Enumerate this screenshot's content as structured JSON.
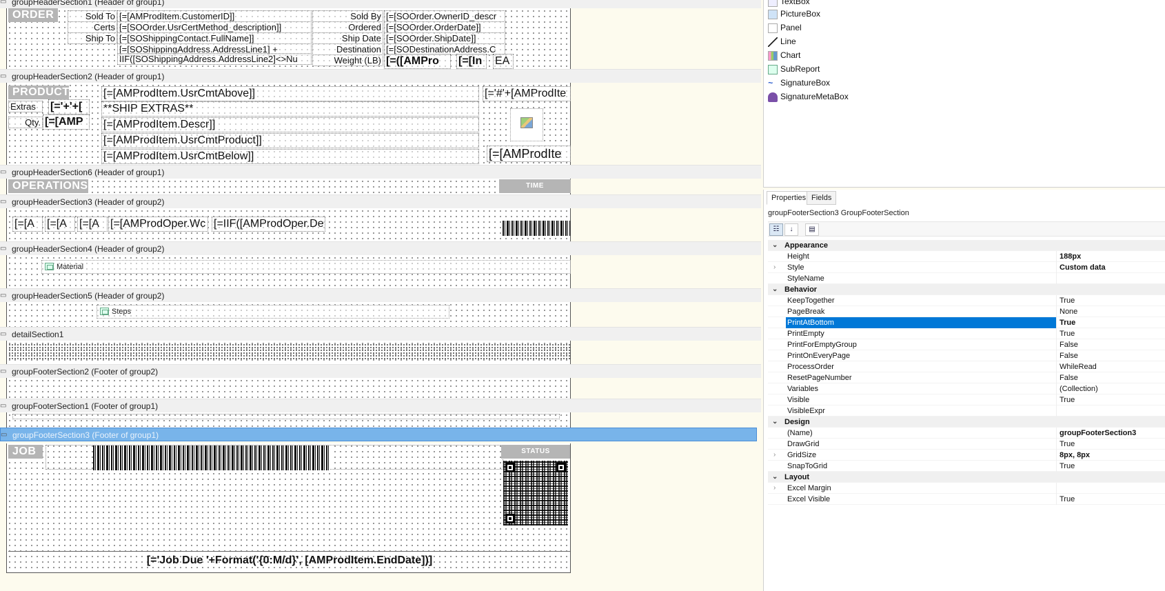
{
  "sections": [
    {
      "label": "groupHeaderSection1 (Header of group1)"
    },
    {
      "label": "groupHeaderSection2 (Header of group1)"
    },
    {
      "label": "groupHeaderSection6 (Header of group1)"
    },
    {
      "label": "groupHeaderSection3 (Header of group2)"
    },
    {
      "label": "groupHeaderSection4 (Header of group2)"
    },
    {
      "label": "groupHeaderSection5 (Header of group2)"
    },
    {
      "label": "detailSection1"
    },
    {
      "label": "groupFooterSection2 (Footer of group2)"
    },
    {
      "label": "groupFooterSection1 (Footer of group1)"
    },
    {
      "label": "groupFooterSection3 (Footer of group1)"
    }
  ],
  "order": {
    "tag": "ORDER",
    "labels_left": [
      "Sold To",
      "Certs",
      "Ship To"
    ],
    "values_left": [
      "[=[AMProdItem.CustomerID]]",
      "[=[SOOrder.UsrCertMethod_description]]",
      "[=[SOShippingContact.FullName]]",
      "[=[SOShippingAddress.AddressLine1] +",
      "IIF([SOShippingAddress.AddressLine2]<>Nu"
    ],
    "labels_right": [
      "Sold By",
      "Ordered",
      "Ship Date",
      "Destination",
      "Weight (LB)"
    ],
    "values_right": [
      "[=[SOOrder.OwnerID_descr",
      "[=[SOOrder.OrderDate]]",
      "[=[SOOrder.ShipDate]]",
      "[=[SODestinationAddress.C"
    ],
    "weight_fields": [
      "[=([AMPro",
      "[=[In",
      "EA"
    ]
  },
  "product": {
    "tag": "PRODUCT",
    "extras_label": "Extras",
    "extras_value": "[='+'+[",
    "qty_label": "Qty.",
    "qty_value": "[=[AMP",
    "lines": [
      "[=[AMProdItem.UsrCmtAbove]]",
      "**SHIP EXTRAS**",
      "[=[AMProdItem.Descr]]",
      "[=[AMProdItem.UsrCmtProduct]]",
      "[=[AMProdItem.UsrCmtBelow]]"
    ],
    "right_top": "[='#'+[AMProdIte",
    "right_bottom": "[=[AMProdIte"
  },
  "operations": {
    "tag": "OPERATIONS",
    "time_tag": "TIME"
  },
  "oper_fields": [
    "[=[A",
    "[=[A",
    "[=[A",
    "[=[AMProdOper.Wc",
    "[=IIF([AMProdOper.De"
  ],
  "material_label": "Material",
  "steps_label": "Steps",
  "job": {
    "tag": "JOB",
    "status_tag": "STATUS",
    "due": "[='Job Due '+Format('{0:M/d}', [AMProdItem.EndDate])]"
  },
  "toolbox": [
    "TextBox",
    "PictureBox",
    "Panel",
    "Line",
    "Chart",
    "SubReport",
    "SignatureBox",
    "SignatureMetaBox"
  ],
  "props": {
    "tabs": [
      "Properties",
      "Fields"
    ],
    "selected_object": "groupFooterSection3 GroupFooterSection",
    "rows": [
      {
        "cat": true,
        "name": "Appearance"
      },
      {
        "name": "Height",
        "value": "188px",
        "bold": true
      },
      {
        "name": "Style",
        "value": "Custom data",
        "bold": true,
        "expand": true
      },
      {
        "name": "StyleName",
        "value": ""
      },
      {
        "cat": true,
        "name": "Behavior"
      },
      {
        "name": "KeepTogether",
        "value": "True"
      },
      {
        "name": "PageBreak",
        "value": "None"
      },
      {
        "name": "PrintAtBottom",
        "value": "True",
        "selected": true
      },
      {
        "name": "PrintEmpty",
        "value": "True"
      },
      {
        "name": "PrintForEmptyGroup",
        "value": "False"
      },
      {
        "name": "PrintOnEveryPage",
        "value": "False"
      },
      {
        "name": "ProcessOrder",
        "value": "WhileRead"
      },
      {
        "name": "ResetPageNumber",
        "value": "False"
      },
      {
        "name": "Variables",
        "value": "(Collection)"
      },
      {
        "name": "Visible",
        "value": "True"
      },
      {
        "name": "VisibleExpr",
        "value": ""
      },
      {
        "cat": true,
        "name": "Design"
      },
      {
        "name": "(Name)",
        "value": "groupFooterSection3",
        "bold": true
      },
      {
        "name": "DrawGrid",
        "value": "True"
      },
      {
        "name": "GridSize",
        "value": "8px, 8px",
        "bold": true,
        "expand": true
      },
      {
        "name": "SnapToGrid",
        "value": "True"
      },
      {
        "cat": true,
        "name": "Layout"
      },
      {
        "name": "Excel Margin",
        "value": "",
        "expand": true
      },
      {
        "name": "Excel Visible",
        "value": "True"
      }
    ]
  },
  "colors": {
    "selection": "#0078d7",
    "section_selected": "#78b4ea",
    "tag_gray": "#b5b5b5",
    "canvas": "#fdfbee"
  }
}
